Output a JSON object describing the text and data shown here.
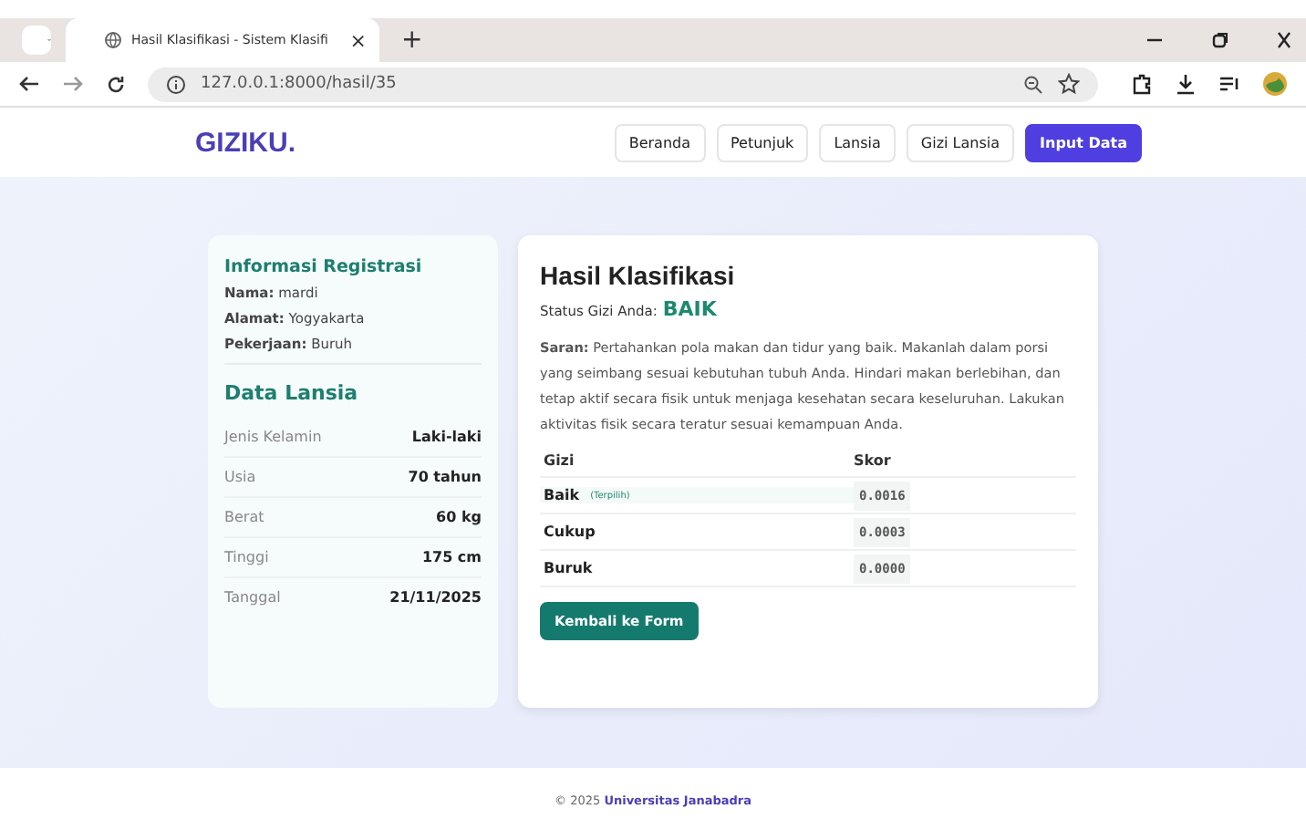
{
  "browser": {
    "tab_title": "Hasil Klasifikasi - Sistem Klasifi",
    "close": "×",
    "new_tab": "+",
    "url": "127.0.0.1:8000/hasil/35"
  },
  "nav": {
    "logo": "GIZIKU.",
    "items": [
      {
        "label": "Beranda",
        "selected": false
      },
      {
        "label": "Petunjuk",
        "selected": false
      },
      {
        "label": "Lansia",
        "selected": false
      },
      {
        "label": "Gizi Lansia",
        "selected": false
      },
      {
        "label": "Input Data",
        "selected": true
      }
    ]
  },
  "registration": {
    "title": "Informasi Registrasi",
    "lines": [
      "**Nama:** mardi",
      "**Alamat:** Yogyakarta",
      "**Pekerjaan:** Buruh"
    ]
  },
  "lansia": {
    "title": "Data Lansia",
    "rows": [
      {
        "label": "Jenis Kelamin",
        "value": "Laki-laki"
      },
      {
        "label": "Usia",
        "value": "70 tahun"
      },
      {
        "label": "Berat",
        "value": "60 kg"
      },
      {
        "label": "Tinggi",
        "value": "175 cm"
      },
      {
        "label": "Tanggal",
        "value": "21/11/2025"
      }
    ]
  },
  "result": {
    "title": "Hasil Klasifikasi",
    "status_label": "Status Gizi Anda:",
    "status": "BAIK",
    "advice": "**Saran:** Pertahankan pola makan dan tidur yang baik. Makanlah dalam porsi yang seimbang sesuai kebutuhan tubuh Anda. Hindari makan berlebihan, dan tetap aktif secara fisik untuk menjaga kesehatan secara keseluruhan. Lakukan aktivitas fisik secara teratur sesuai kemampuan Anda.",
    "columns": [
      "Gizi",
      "Skor"
    ],
    "selected_tag": "(Terpilih)",
    "rows": [
      {
        "name": "Baik",
        "score": "0.0016",
        "selected": true
      },
      {
        "name": "Cukup",
        "score": "0.0003",
        "selected": false
      },
      {
        "name": "Buruk",
        "score": "0.0000",
        "selected": false
      }
    ],
    "back_button": "Kembali ke Form"
  },
  "footer": {
    "copyright": "© 2025",
    "org": "Universitas Janabadra"
  }
}
